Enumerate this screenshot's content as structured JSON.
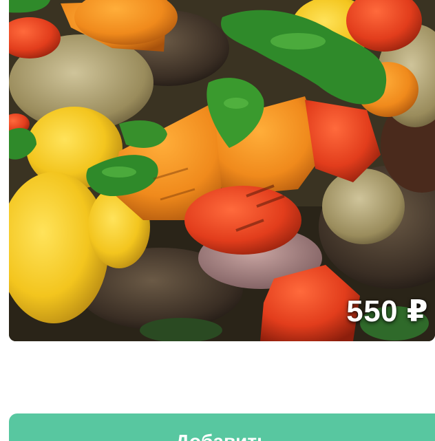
{
  "product": {
    "image_icon": "grilled-vegetables-photo",
    "price": "550 ₽"
  },
  "actions": {
    "add_label": "Добавить"
  },
  "colors": {
    "button": "#58c7a0",
    "price_text": "#ffffff"
  }
}
